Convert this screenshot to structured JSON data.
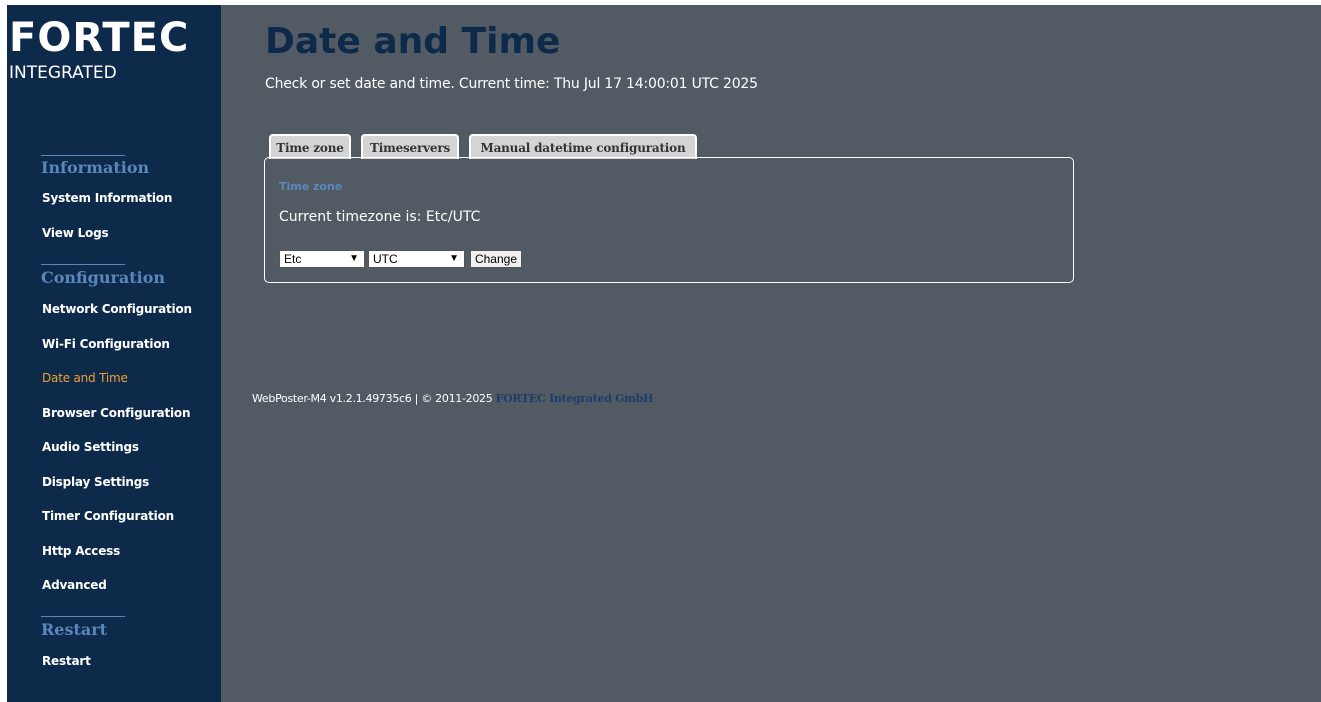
{
  "brand": {
    "logo_main": "FORTEC",
    "logo_sub": "INTEGRATED"
  },
  "sidebar": {
    "sections": [
      {
        "title": "Information",
        "items": [
          "System Information",
          "View Logs"
        ]
      },
      {
        "title": "Configuration",
        "items": [
          "Network Configuration",
          "Wi-Fi Configuration",
          "Date and Time",
          "Browser Configuration",
          "Audio Settings",
          "Display Settings",
          "Timer Configuration",
          "Http Access",
          "Advanced"
        ]
      },
      {
        "title": "Restart",
        "items": [
          "Restart"
        ]
      }
    ],
    "active_item": "Date and Time"
  },
  "page": {
    "title": "Date and Time",
    "subtitle": "Check or set date and time. Current time: Thu Jul 17 14:00:01 UTC 2025"
  },
  "tabs": [
    {
      "label": "Time zone",
      "active": true
    },
    {
      "label": "Timeservers",
      "active": false
    },
    {
      "label": "Manual datetime configuration",
      "active": false
    }
  ],
  "panel": {
    "label": "Time zone",
    "current_text": "Current timezone is: Etc/UTC",
    "region_select": "Etc",
    "zone_select": "UTC",
    "change_button": "Change"
  },
  "footer": {
    "text": "WebPoster-M4 v1.2.1.49735c6 | © 2011-2025 ",
    "company": "FORTEC Integrated GmbH"
  },
  "colors": {
    "sidebar_bg": "#0d2a4a",
    "content_bg": "#525a63",
    "section_title": "#5b87bd",
    "active_nav": "#f0a030",
    "title": "#0d2a4a"
  }
}
